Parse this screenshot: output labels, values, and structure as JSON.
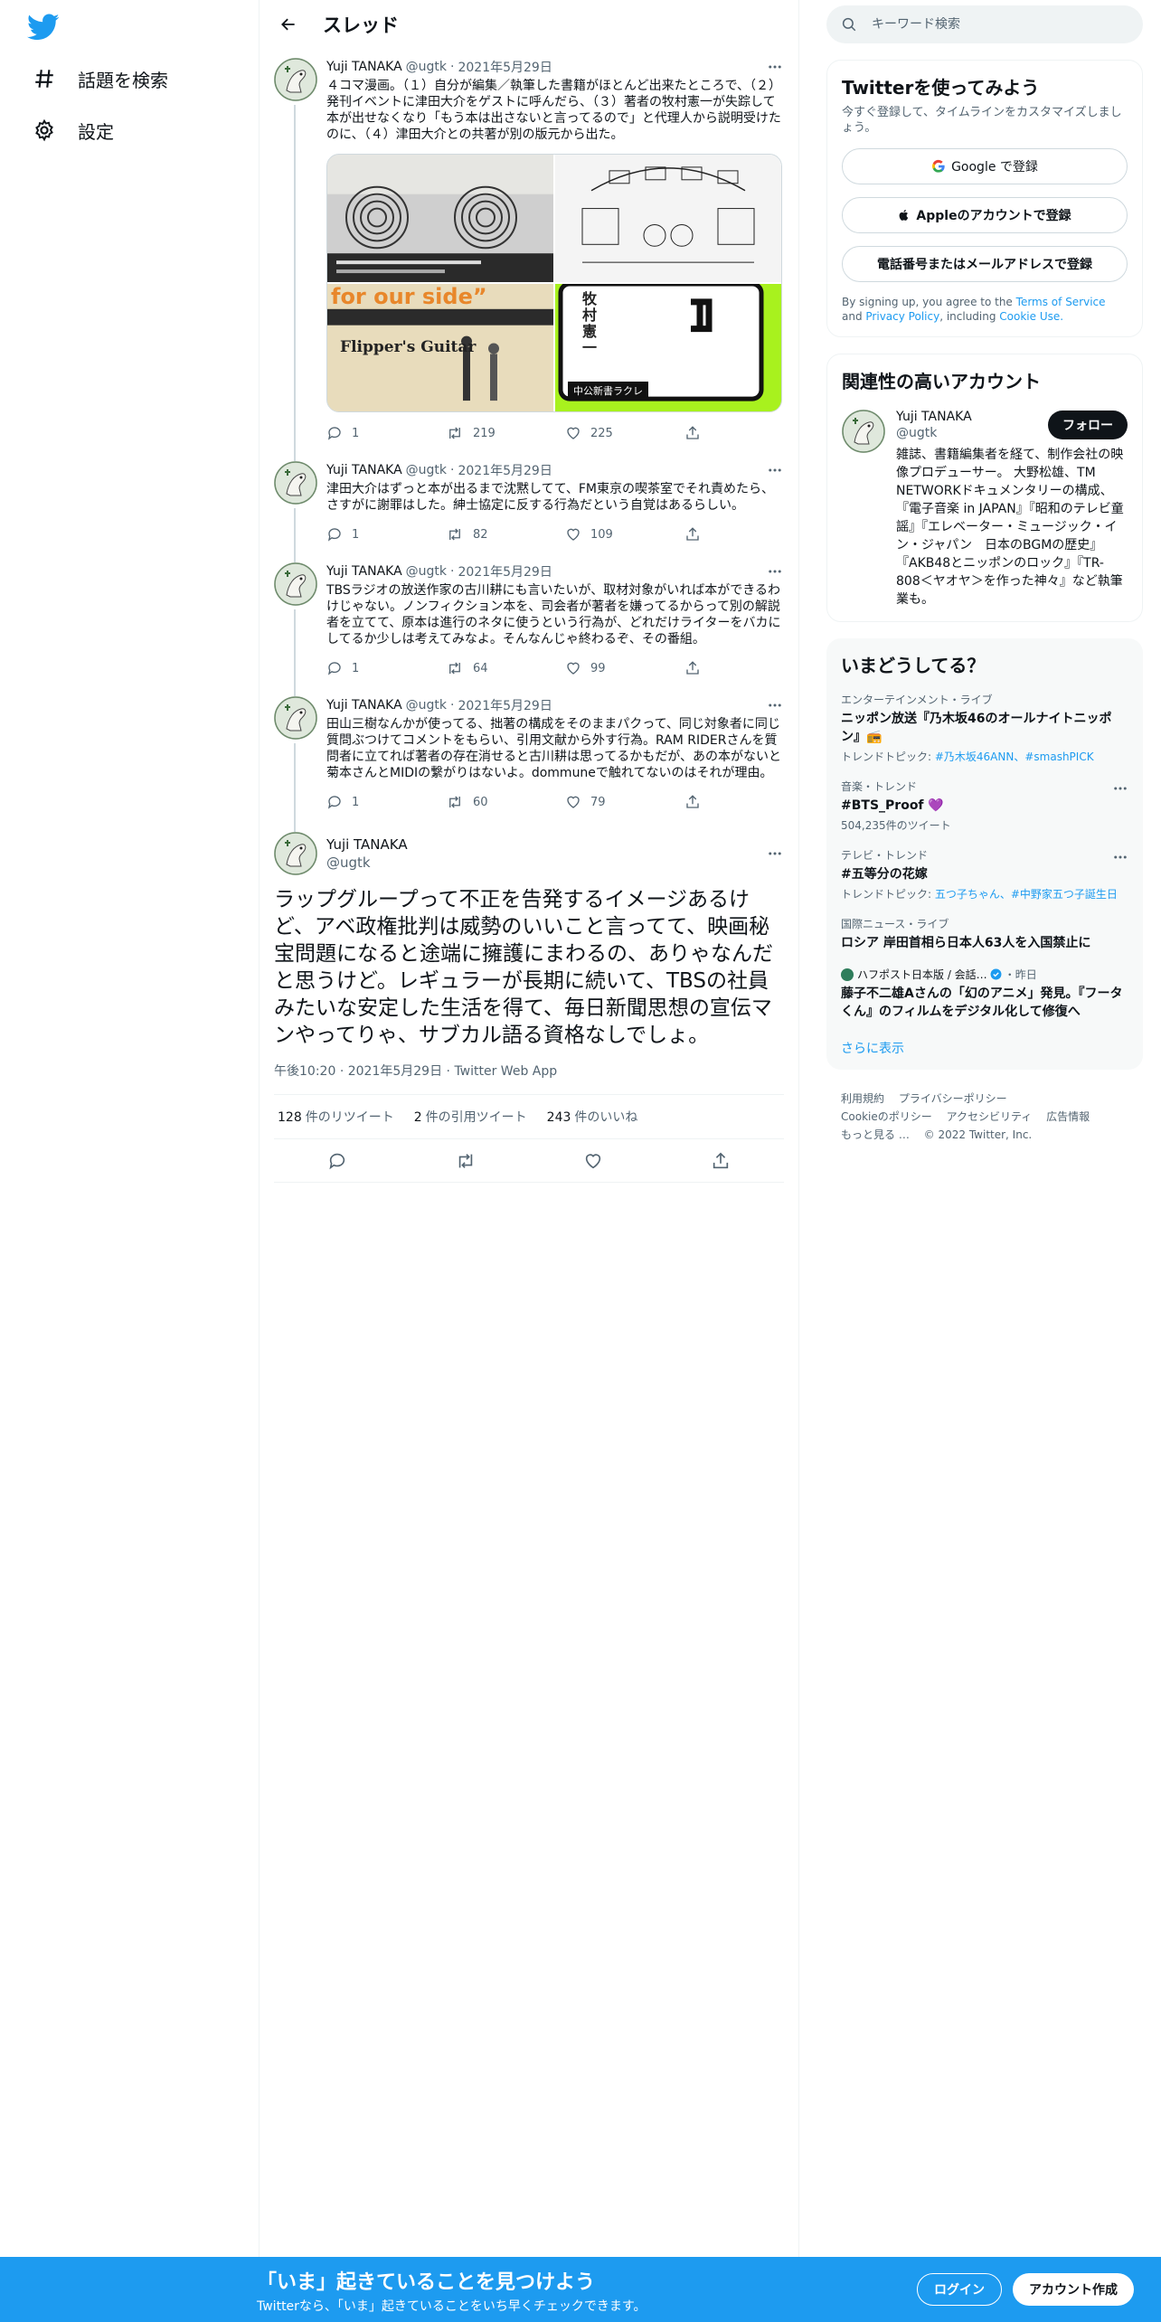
{
  "nav": {
    "explore_label": "話題を検索",
    "settings_label": "設定"
  },
  "header": {
    "title": "スレッド"
  },
  "tweets": [
    {
      "name": "Yuji TANAKA",
      "handle": "@ugtk",
      "date": "2021年5月29日",
      "text": "４コマ漫画。（１）自分が編集／執筆した書籍がほとんど出来たところで、（２）発刊イベントに津田大介をゲストに呼んだら、（３）著者の牧村憲一が失踪して本が出せなくなり「もう本は出さないと言ってるので」と代理人から説明受けたのに、（４）津田大介との共著が別の版元から出た。",
      "replies": "1",
      "retweets": "219",
      "likes": "225",
      "media": {
        "tile1": "",
        "tile2": "",
        "tile3_word": "for our side”",
        "tile3_caption": "Flipper's Guitar",
        "tile4_author": "牧村憲一",
        "tile4_label": "中公新書ラクレ"
      }
    },
    {
      "name": "Yuji TANAKA",
      "handle": "@ugtk",
      "date": "2021年5月29日",
      "text": "津田大介はずっと本が出るまで沈黙してて、FM東京の喫茶室でそれ責めたら、さすがに謝罪はした。紳士協定に反する行為だという自覚はあるらしい。",
      "replies": "1",
      "retweets": "82",
      "likes": "109"
    },
    {
      "name": "Yuji TANAKA",
      "handle": "@ugtk",
      "date": "2021年5月29日",
      "text": "TBSラジオの放送作家の古川耕にも言いたいが、取材対象がいれば本ができるわけじゃない。ノンフィクション本を、司会者が著者を嫌ってるからって別の解説者を立てて、原本は進行のネタに使うという行為が、どれだけライターをバカにしてるか少しは考えてみなよ。そんなんじゃ終わるぞ、その番組。",
      "replies": "1",
      "retweets": "64",
      "likes": "99"
    },
    {
      "name": "Yuji TANAKA",
      "handle": "@ugtk",
      "date": "2021年5月29日",
      "text": "田山三樹なんかが使ってる、拙著の構成をそのままパクって、同じ対象者に同じ質問ぶつけてコメントをもらい、引用文献から外す行為。RAM RIDERさんを質問者に立てれば著者の存在消せると古川耕は思ってるかもだが、あの本がないと菊本さんとMIDIの繋がりはないよ。dommuneで触れてないのはそれが理由。",
      "replies": "1",
      "retweets": "60",
      "likes": "79"
    }
  ],
  "focus": {
    "name": "Yuji TANAKA",
    "handle": "@ugtk",
    "text": "ラップグループって不正を告発するイメージあるけど、アベ政権批判は威勢のいいこと言ってて、映画秘宝問題になると途端に擁護にまわるの、ありゃなんだと思うけど。レギュラーが長期に続いて、TBSの社員みたいな安定した生活を得て、毎日新聞思想の宣伝マンやってりゃ、サブカル語る資格なしでしょ。",
    "time": "午後10:20",
    "date": "2021年5月29日",
    "source": "Twitter Web App",
    "retweets_count": "128",
    "retweets_label": "件のリツイート",
    "quotes_count": "2",
    "quotes_label": "件の引用ツイート",
    "likes_count": "243",
    "likes_label": "件のいいね"
  },
  "search": {
    "placeholder": "キーワード検索"
  },
  "signup_card": {
    "title": "Twitterを使ってみよう",
    "subtitle": "今すぐ登録して、タイムラインをカスタマイズしましょう。",
    "google_label": "Google で登録",
    "apple_label": "Appleのアカウントで登録",
    "phone_label": "電話番号またはメールアドレスで登録",
    "terms_pre": "By signing up, you agree to the",
    "terms_link": "Terms of Service",
    "terms_and": "and",
    "privacy_link": "Privacy Policy",
    "including": ", including",
    "cookie_link": "Cookie Use."
  },
  "related": {
    "title": "関連性の高いアカウント",
    "name": "Yuji TANAKA",
    "handle": "@ugtk",
    "follow_label": "フォロー",
    "bio": "雑誌、書籍編集者を経て、制作会社の映像プロデューサー。 大野松雄、TM NETWORKドキュメンタリーの構成、『電子音楽 in JAPAN』『昭和のテレビ童謡』『エレベーター・ミュージック・イン・ジャパン　日本のBGMの歴史』『AKB48とニッポンのロック』『TR-808＜ヤオヤ＞を作った神々』など執筆業も。"
  },
  "trends": {
    "title": "いまどうしてる？",
    "items": [
      {
        "context": "エンターテインメント・ライブ",
        "title": "ニッポン放送『乃木坂46のオールナイトニッポン』📻",
        "sub_prefix": "トレンドトピック: ",
        "sub_links": "#乃木坂46ANN、#smashPICK"
      },
      {
        "context": "音楽・トレンド",
        "title": "#BTS_Proof 💜",
        "sub": "504,235件のツイート"
      },
      {
        "context": "テレビ・トレンド",
        "title": "#五等分の花嫁",
        "sub_prefix": "トレンドトピック: ",
        "sub_links": "五つ子ちゃん、#中野家五つ子誕生日"
      },
      {
        "context": "国際ニュース・ライブ",
        "title": "ロシア 岸田首相ら日本人63人を入国禁止に"
      },
      {
        "source": "ハフポスト日本版 / 会話…",
        "when": "・昨日",
        "title": "藤子不二雄Aさんの「幻のアニメ」発見。『フータくん』のフィルムをデジタル化して修復へ"
      }
    ],
    "show_more": "さらに表示"
  },
  "footer": {
    "terms": "利用規約",
    "privacy": "プライバシーポリシー",
    "cookie": "Cookieのポリシー",
    "accessibility": "アクセシビリティ",
    "ads": "広告情報",
    "more": "もっと見る …",
    "copyright": "© 2022 Twitter, Inc."
  },
  "banner": {
    "headline": "「いま」起きていることを見つけよう",
    "sub": "Twitterなら、「いま」起きていることをいち早くチェックできます。",
    "login": "ログイン",
    "signup": "アカウント作成"
  },
  "colors": {
    "accent": "#1d9bf0",
    "text": "#0f1419",
    "muted": "#536471",
    "border": "#eff3f4"
  }
}
